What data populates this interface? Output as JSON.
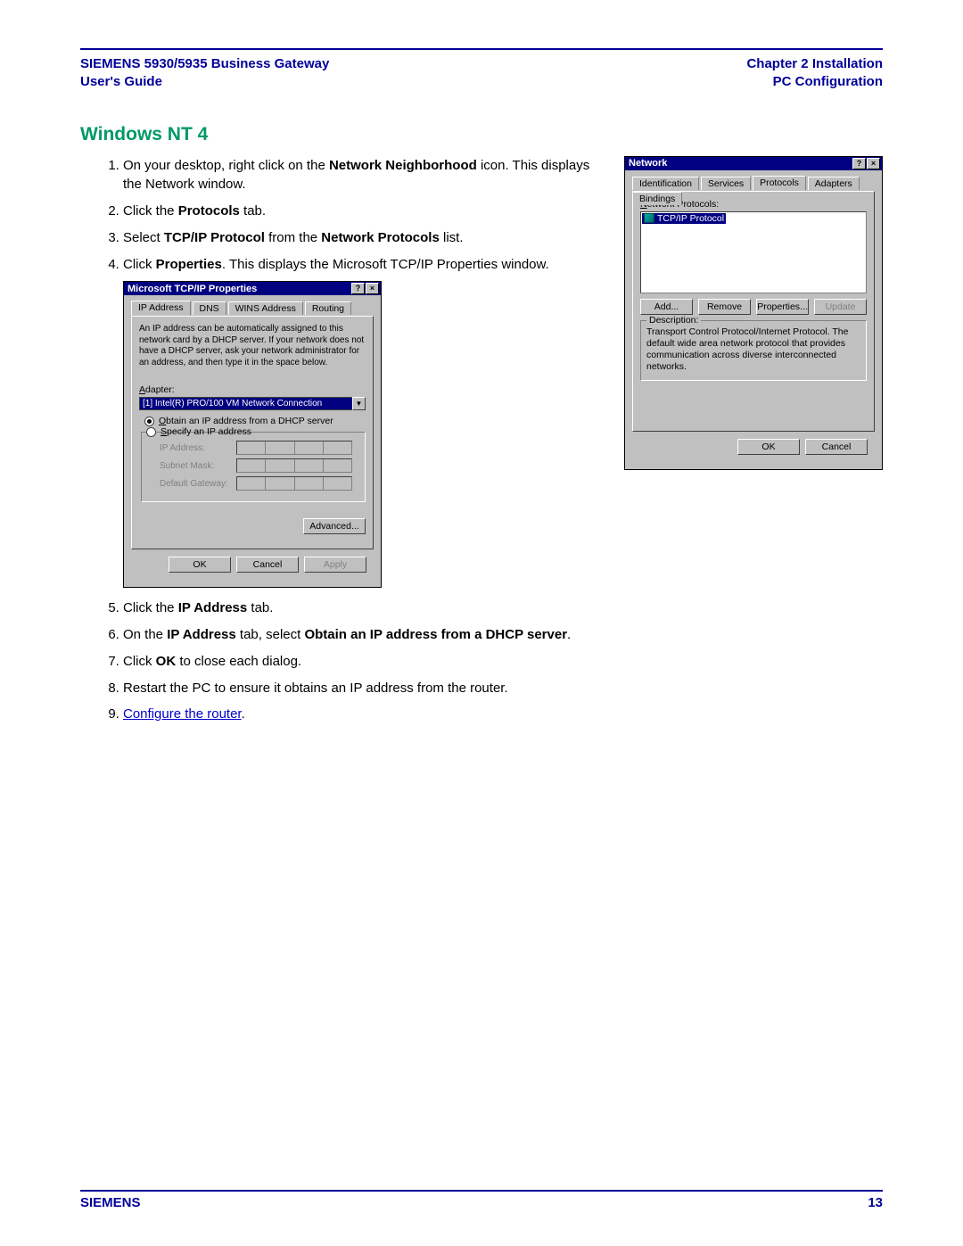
{
  "header": {
    "left_line1": "SIEMENS 5930/5935 Business Gateway",
    "left_line2": "User's Guide",
    "right_line1": "Chapter 2  Installation",
    "right_line2": "PC Configuration"
  },
  "section_title": "Windows NT 4",
  "steps": {
    "s1a": "On your desktop, right click on the ",
    "s1b": "Network Neighborhood",
    "s1c": " icon. This displays the Network window.",
    "s2a": "Click the ",
    "s2b": "Protocols",
    "s2c": " tab.",
    "s3a": "Select ",
    "s3b": "TCP/IP Protocol",
    "s3c": " from the ",
    "s3d": "Network Protocols",
    "s3e": " list.",
    "s4a": " Click ",
    "s4b": "Properties",
    "s4c": ". This displays the Microsoft TCP/IP Properties window.",
    "s5a": "Click the ",
    "s5b": "IP Address",
    "s5c": " tab.",
    "s6a": "On the ",
    "s6b": "IP Address",
    "s6c": " tab, select ",
    "s6d": "Obtain an IP address from a DHCP server",
    "s6e": ".",
    "s7a": "Click ",
    "s7b": "OK",
    "s7c": " to close each dialog.",
    "s8": "Restart the PC to ensure it obtains an IP address from the router.",
    "s9_link": "Configure the router",
    "s9_dot": "."
  },
  "network_dialog": {
    "title": "Network",
    "tabs": [
      "Identification",
      "Services",
      "Protocols",
      "Adapters",
      "Bindings"
    ],
    "list_label_pre": "N",
    "list_label": "etwork Protocols:",
    "item": "TCP/IP Protocol",
    "buttons": {
      "add": "Add...",
      "remove": "Remove",
      "props": "Properties...",
      "update": "Update"
    },
    "desc_label": "Description:",
    "desc_text": "Transport Control Protocol/Internet Protocol. The default wide area network protocol that provides communication across diverse interconnected networks.",
    "ok": "OK",
    "cancel": "Cancel"
  },
  "tcpip_dialog": {
    "title": "Microsoft TCP/IP Properties",
    "tabs": [
      "IP Address",
      "DNS",
      "WINS Address",
      "Routing"
    ],
    "info": "An IP address can be automatically assigned to this network card by a DHCP server.  If your network does not have a DHCP server, ask your network administrator for an address, and then type it in the space below.",
    "adapter_u": "A",
    "adapter_label": "dapter:",
    "adapter_value": "[1] Intel(R) PRO/100 VM Network Connection",
    "radio_obtain_u": "O",
    "radio_obtain": "btain an IP address from a DHCP server",
    "radio_specify_u": "S",
    "radio_specify": "pecify an IP address",
    "ip_lbl": "IP Address:",
    "subnet_lbl": "Subnet Mask:",
    "gw_lbl": "Default Gateway:",
    "advanced": "Advanced...",
    "ok": "OK",
    "cancel": "Cancel",
    "apply": "Apply"
  },
  "footer": {
    "brand": "SIEMENS",
    "page": "13"
  }
}
